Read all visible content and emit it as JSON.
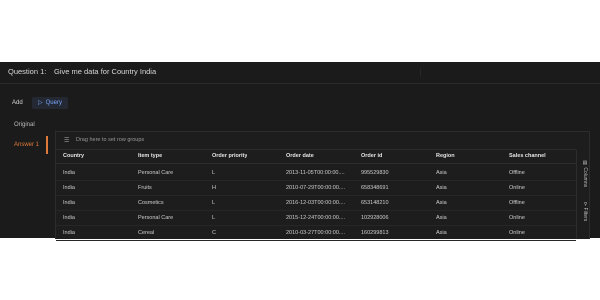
{
  "question": {
    "label": "Question 1:",
    "text": "Give me data for Country India"
  },
  "toolbar": {
    "add_label": "Add",
    "query_label": "Query",
    "query_icon": "play-icon"
  },
  "sidebar": {
    "items": [
      {
        "label": "Original"
      },
      {
        "label": "Answer 1"
      }
    ],
    "accent_color": "#e07a3a"
  },
  "grid": {
    "group_hint": "Drag here to set row groups",
    "columns": [
      "Country",
      "Item type",
      "Order priority",
      "Order date",
      "Order id",
      "Region",
      "Sales channel"
    ],
    "rows": [
      [
        "India",
        "Personal Care",
        "L",
        "2013-11-05T00:00:00....",
        "995529830",
        "Asia",
        "Offline"
      ],
      [
        "India",
        "Fruits",
        "H",
        "2010-07-29T00:00:00....",
        "658348691",
        "Asia",
        "Online"
      ],
      [
        "India",
        "Cosmetics",
        "L",
        "2016-12-03T00:00:00....",
        "653148210",
        "Asia",
        "Offline"
      ],
      [
        "India",
        "Personal Care",
        "L",
        "2015-12-24T00:00:00....",
        "102928006",
        "Asia",
        "Online"
      ],
      [
        "India",
        "Cereal",
        "C",
        "2010-03-27T00:00:00....",
        "160299813",
        "Asia",
        "Online"
      ]
    ],
    "side_tabs": {
      "columns": "Columns",
      "filters": "Filters"
    }
  }
}
